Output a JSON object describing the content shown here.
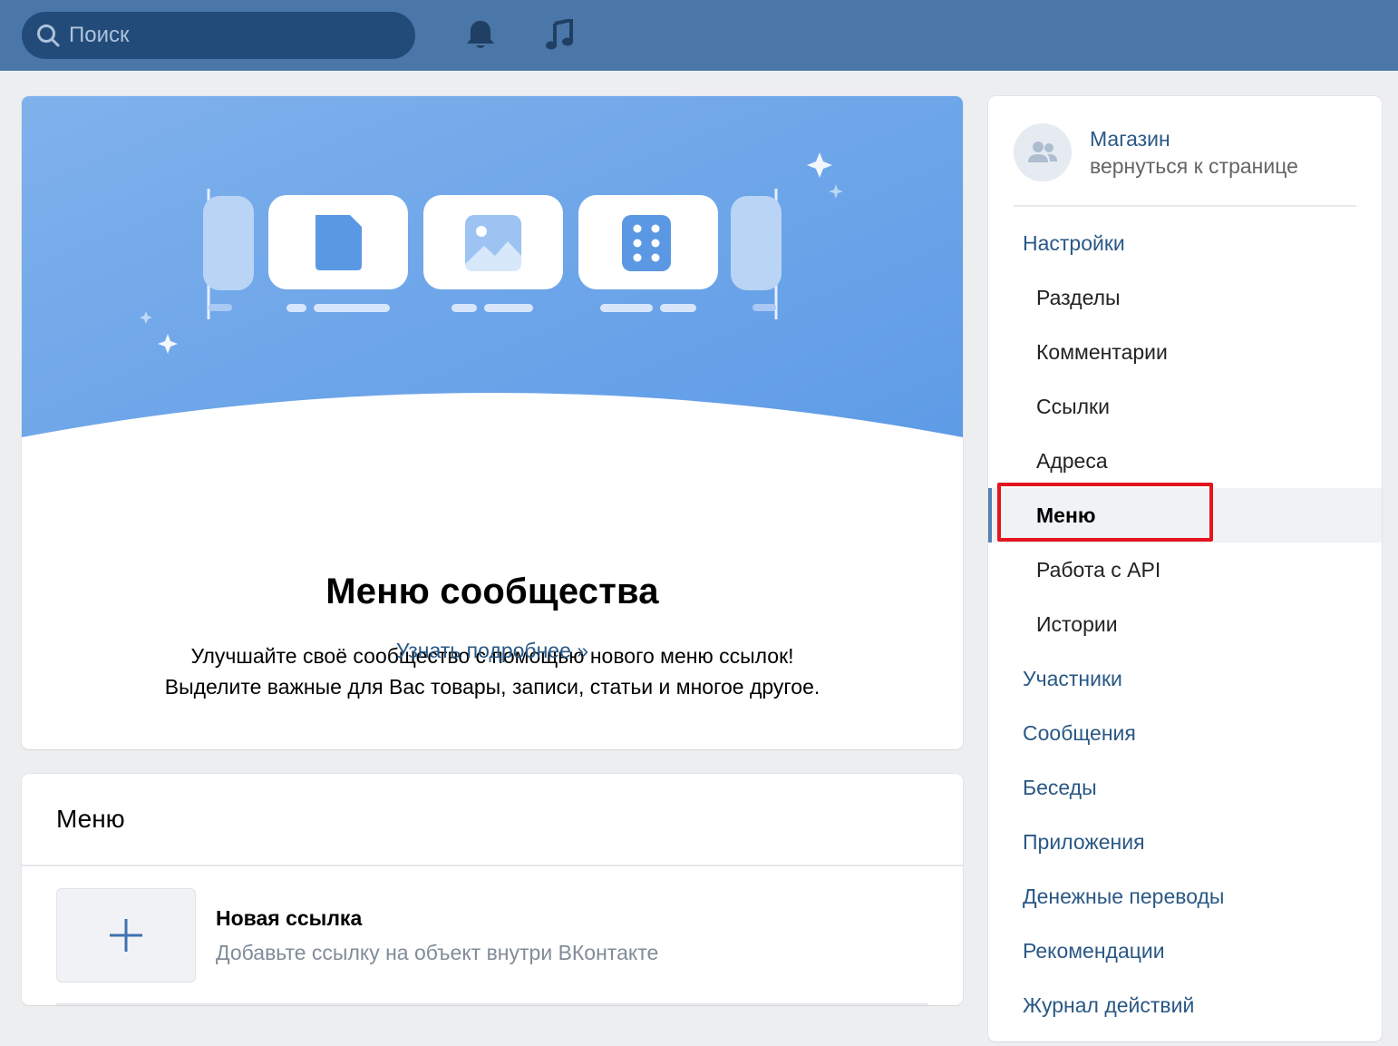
{
  "header": {
    "search_placeholder": "Поиск",
    "icons": [
      "search-icon",
      "bell-icon",
      "music-icon"
    ]
  },
  "hero": {
    "title": "Меню сообщества",
    "text_line1": "Улучшайте своё сообщество с помощью нового меню ссылок!",
    "text_line2": "Выделите важные для Вас товары, записи, статьи и многое другое.",
    "link": "Узнать подробнее »"
  },
  "menu_block": {
    "title": "Меню",
    "new_link_title": "Новая ссылка",
    "new_link_subtitle": "Добавьте ссылку на объект внутри ВКонтакте"
  },
  "sidebar": {
    "group_name": "Магазин",
    "group_back": "вернуться к странице",
    "items": [
      {
        "label": "Настройки"
      },
      {
        "label": "Разделы"
      },
      {
        "label": "Комментарии"
      },
      {
        "label": "Ссылки"
      },
      {
        "label": "Адреса"
      },
      {
        "label": "Меню"
      },
      {
        "label": "Работа с API"
      },
      {
        "label": "Истории"
      },
      {
        "label": "Участники"
      },
      {
        "label": "Сообщения"
      },
      {
        "label": "Беседы"
      },
      {
        "label": "Приложения"
      },
      {
        "label": "Денежные переводы"
      },
      {
        "label": "Рекомендации"
      },
      {
        "label": "Журнал действий"
      }
    ]
  },
  "colors": {
    "topbar": "#4a76a8",
    "link": "#2a5885",
    "highlight": "#e3151f",
    "hero_gradient_start": "#7fb1ec",
    "hero_gradient_end": "#5c9ae6"
  }
}
